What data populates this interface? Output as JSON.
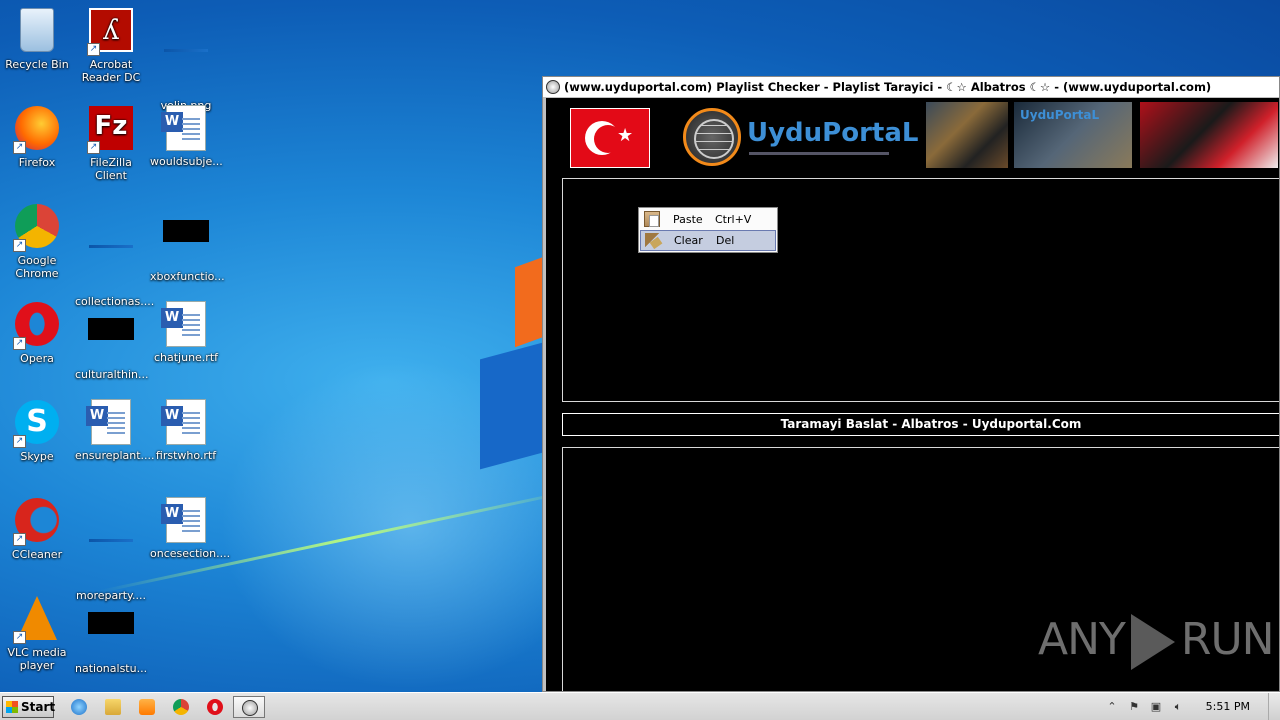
{
  "desktop": {
    "icons": [
      {
        "label": "Recycle Bin",
        "type": "bin"
      },
      {
        "label": "Acrobat Reader DC",
        "type": "acrobat"
      },
      {
        "label": "volin.png",
        "type": "thin"
      },
      {
        "label": "Firefox",
        "type": "firefox"
      },
      {
        "label": "FileZilla Client",
        "type": "filezilla"
      },
      {
        "label": "wouldsubje...",
        "type": "doc"
      },
      {
        "label": "Google Chrome",
        "type": "chrome"
      },
      {
        "label": "collectionas....",
        "type": "thin"
      },
      {
        "label": "xboxfunctio...",
        "type": "black"
      },
      {
        "label": "Opera",
        "type": "opera"
      },
      {
        "label": "culturalthin...",
        "type": "black"
      },
      {
        "label": "chatjune.rtf",
        "type": "doc"
      },
      {
        "label": "Skype",
        "type": "skype"
      },
      {
        "label": "ensureplant....",
        "type": "doc"
      },
      {
        "label": "firstwho.rtf",
        "type": "doc"
      },
      {
        "label": "CCleaner",
        "type": "ccleaner"
      },
      {
        "label": "moreparty....",
        "type": "thin"
      },
      {
        "label": "oncesection....",
        "type": "doc"
      },
      {
        "label": "VLC media player",
        "type": "vlc"
      },
      {
        "label": "nationalstu...",
        "type": "black"
      }
    ]
  },
  "window": {
    "title": "(www.uyduportal.com) Playlist Checker - Playlist Tarayici - ☾☆ Albatros ☾☆ - (www.uyduportal.com)",
    "brand_name": "UyduPortaL",
    "collage_brand": "UyduPortaL",
    "scan_button": "Taramayi Baslat - Albatros - Uyduportal.Com"
  },
  "context_menu": {
    "items": [
      {
        "label": "Paste",
        "shortcut": "Ctrl+V",
        "highlighted": false
      },
      {
        "label": "Clear",
        "shortcut": "Del",
        "highlighted": true
      }
    ]
  },
  "watermark": {
    "left": "ANY",
    "right": "RUN"
  },
  "taskbar": {
    "start_label": "Start",
    "clock": "5:51 PM",
    "tray_expand": "⌃"
  }
}
